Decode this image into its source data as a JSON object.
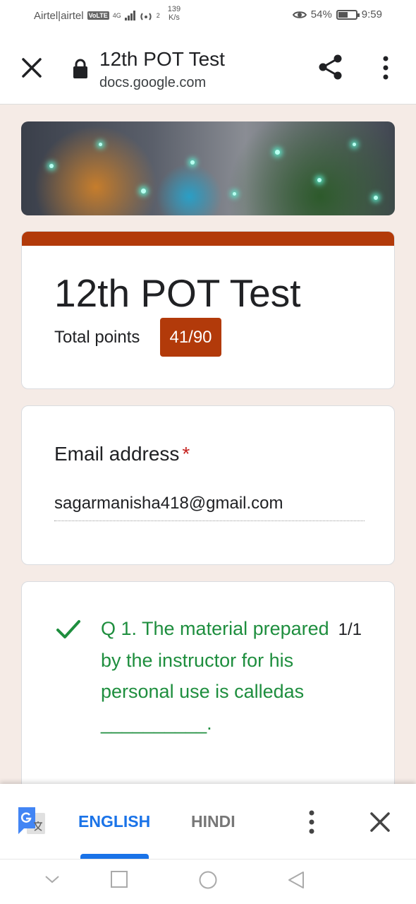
{
  "status_bar": {
    "carrier": "Airtel|airtel",
    "volte": "VoLTE",
    "network": "4G",
    "hotspot_count": "2",
    "speed_value": "139",
    "speed_unit": "K/s",
    "battery": "54%",
    "time": "9:59",
    "battery_level": 0.54
  },
  "header": {
    "title": "12th POT Test",
    "domain": "docs.google.com",
    "icons": [
      "close-icon",
      "lock-icon",
      "share-icon",
      "more-vert-icon"
    ]
  },
  "form": {
    "title": "12th POT Test",
    "total_points_label": "Total points",
    "score": "41/90",
    "accent_color": "#b23a0a"
  },
  "email": {
    "label": "Email address",
    "required_mark": "*",
    "value": "sagarmanisha418@gmail.com"
  },
  "question": {
    "text": "Q 1. The material prepared by the instructor for his personal use is calledas __________.",
    "score": "1/1",
    "status": "correct",
    "color": "#1e8e3e"
  },
  "translate_bar": {
    "languages": [
      "ENGLISH",
      "HINDI"
    ],
    "selected": "ENGLISH"
  }
}
